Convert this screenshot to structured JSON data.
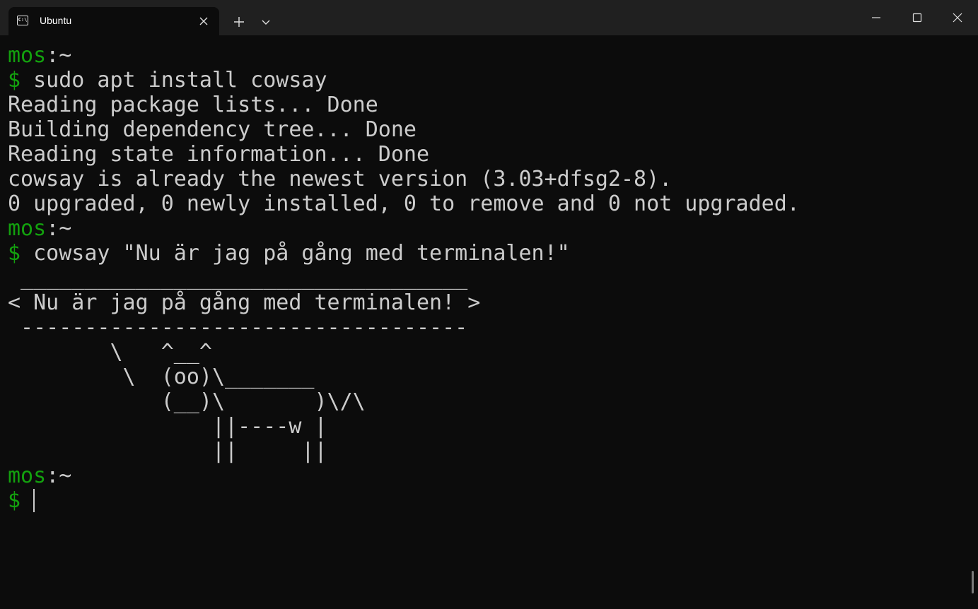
{
  "tab": {
    "title": "Ubuntu",
    "icon": "terminal-icon",
    "icon_glyph": "C:\\"
  },
  "titlebar_icons": {
    "new_tab": "plus-icon",
    "dropdown": "chevron-down-icon",
    "minimize": "minimize-icon",
    "maximize": "maximize-icon",
    "close": "close-icon"
  },
  "colors": {
    "background": "#0c0c0c",
    "titlebar": "#202020",
    "text": "#cccccc",
    "prompt": "#13a10e"
  },
  "terminal": {
    "lines": [
      {
        "type": "prompt",
        "user": "mos",
        "path": ":~"
      },
      {
        "type": "command",
        "symbol": "$",
        "text": " sudo apt install cowsay"
      },
      {
        "type": "output",
        "text": "Reading package lists... Done"
      },
      {
        "type": "output",
        "text": "Building dependency tree... Done"
      },
      {
        "type": "output",
        "text": "Reading state information... Done"
      },
      {
        "type": "output",
        "text": "cowsay is already the newest version (3.03+dfsg2-8)."
      },
      {
        "type": "output",
        "text": "0 upgraded, 0 newly installed, 0 to remove and 0 not upgraded."
      },
      {
        "type": "prompt",
        "user": "mos",
        "path": ":~"
      },
      {
        "type": "command",
        "symbol": "$",
        "text": " cowsay \"Nu är jag på gång med terminalen!\""
      },
      {
        "type": "output",
        "text": " ___________________________________"
      },
      {
        "type": "output",
        "text": "< Nu är jag på gång med terminalen! >"
      },
      {
        "type": "output",
        "text": " -----------------------------------"
      },
      {
        "type": "output",
        "text": "        \\   ^__^"
      },
      {
        "type": "output",
        "text": "         \\  (oo)\\_______"
      },
      {
        "type": "output",
        "text": "            (__)\\       )\\/\\"
      },
      {
        "type": "output",
        "text": "                ||----w |"
      },
      {
        "type": "output",
        "text": "                ||     ||"
      },
      {
        "type": "prompt",
        "user": "mos",
        "path": ":~"
      },
      {
        "type": "input",
        "symbol": "$",
        "text": " "
      }
    ]
  }
}
